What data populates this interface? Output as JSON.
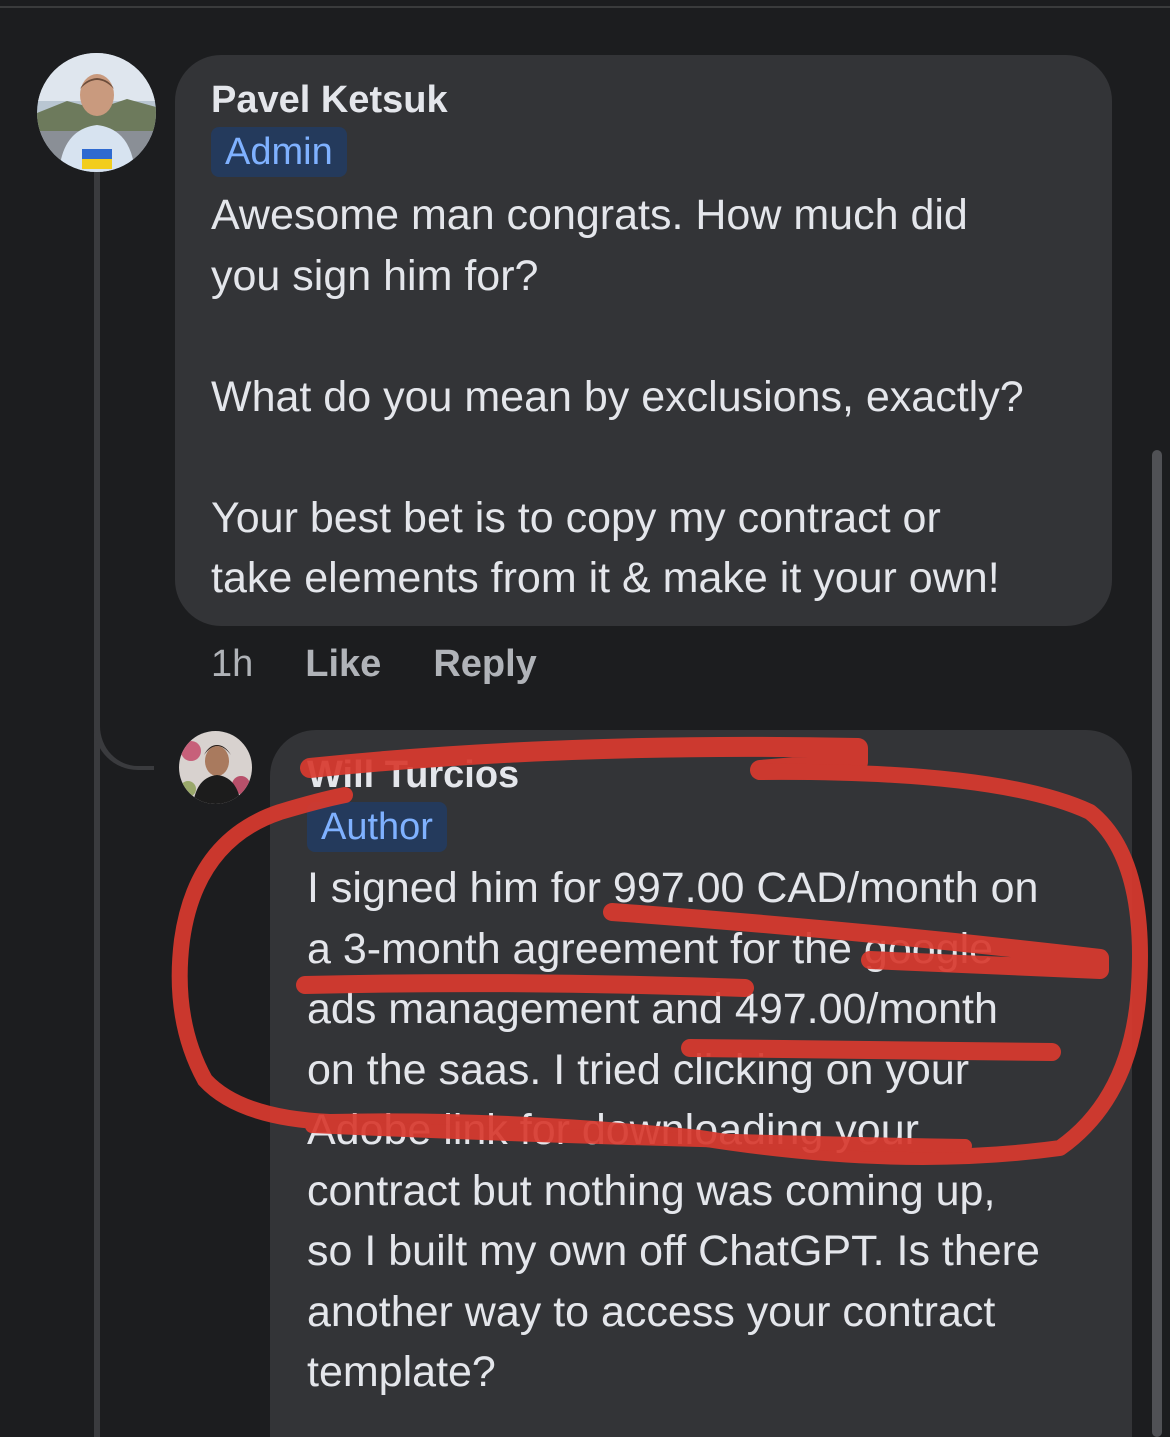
{
  "comments": [
    {
      "author": "Pavel Ketsuk",
      "role": "Admin",
      "text": "Awesome man congrats. How much did\nyou sign him for?\n\nWhat do you mean by exclusions, exactly?\n\nYour best bet is to copy my contract or\ntake elements from it & make it your own!",
      "time": "1h",
      "like_label": "Like",
      "reply_label": "Reply"
    },
    {
      "author": "Will Turcios",
      "role": "Author",
      "text": "I signed him for 997.00 CAD/month on\na 3-month agreement for the google\nads management and 497.00/month\non the saas. I tried clicking on your\nAdobe link for downloading your\ncontract but nothing was coming up,\nso I built my own off ChatGPT. Is there\nanother way to access your contract\ntemplate?"
    }
  ],
  "colors": {
    "background": "#1c1d1f",
    "bubble": "#333437",
    "badge_bg": "#243a5c",
    "badge_text": "#7fb1ff",
    "annotation": "#d93a2f"
  }
}
